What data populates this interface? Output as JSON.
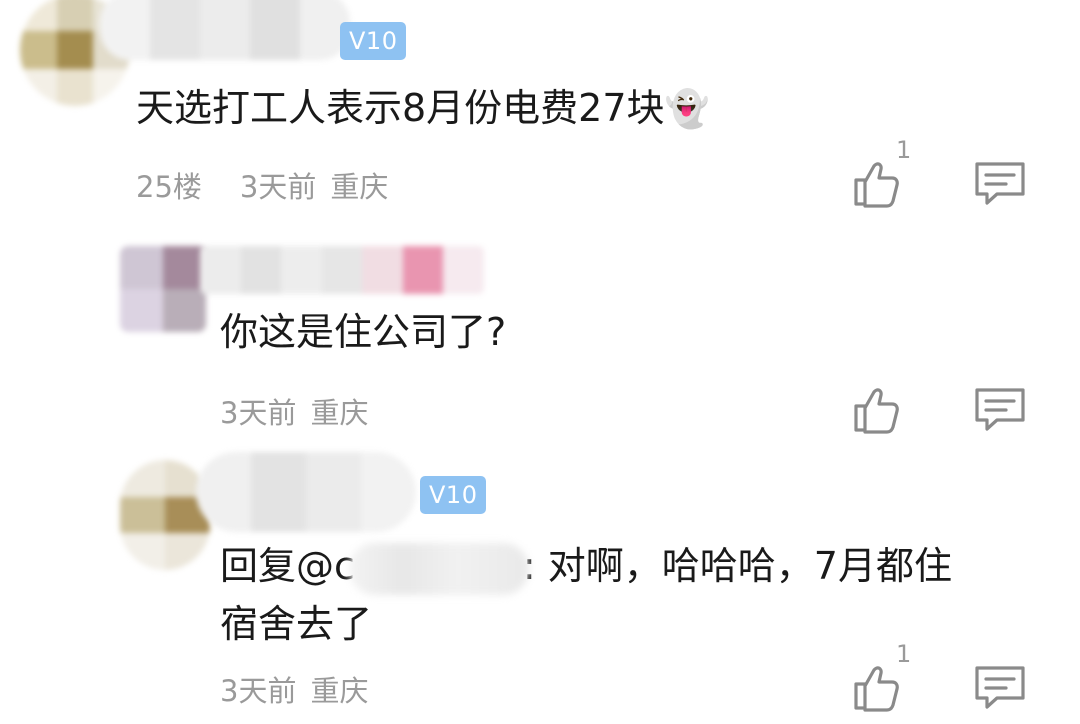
{
  "comments": [
    {
      "badge": "V10",
      "text": "天选打工人表示8月份电费27块",
      "emoji": "👻",
      "floor": "25楼",
      "time": "3天前",
      "location": "重庆",
      "like_count": "1",
      "icons": [
        "thumbs-up-icon",
        "reply-comment-icon"
      ]
    },
    {
      "text": "你这是住公司了?",
      "time": "3天前",
      "location": "重庆",
      "like_count": "",
      "icons": [
        "thumbs-up-icon",
        "reply-comment-icon"
      ]
    },
    {
      "badge": "V10",
      "reply_prefix": "回复@c",
      "text_rest": ": 对啊，哈哈哈，7月都住",
      "text_line2": "宿舍去了",
      "time": "3天前",
      "location": "重庆",
      "like_count": "1",
      "icons": [
        "thumbs-up-icon",
        "reply-comment-icon"
      ]
    }
  ],
  "colors": {
    "badge": "#8ec2f2",
    "meta_text": "#9a9a9a",
    "icon_stroke": "#8a8a8a"
  }
}
